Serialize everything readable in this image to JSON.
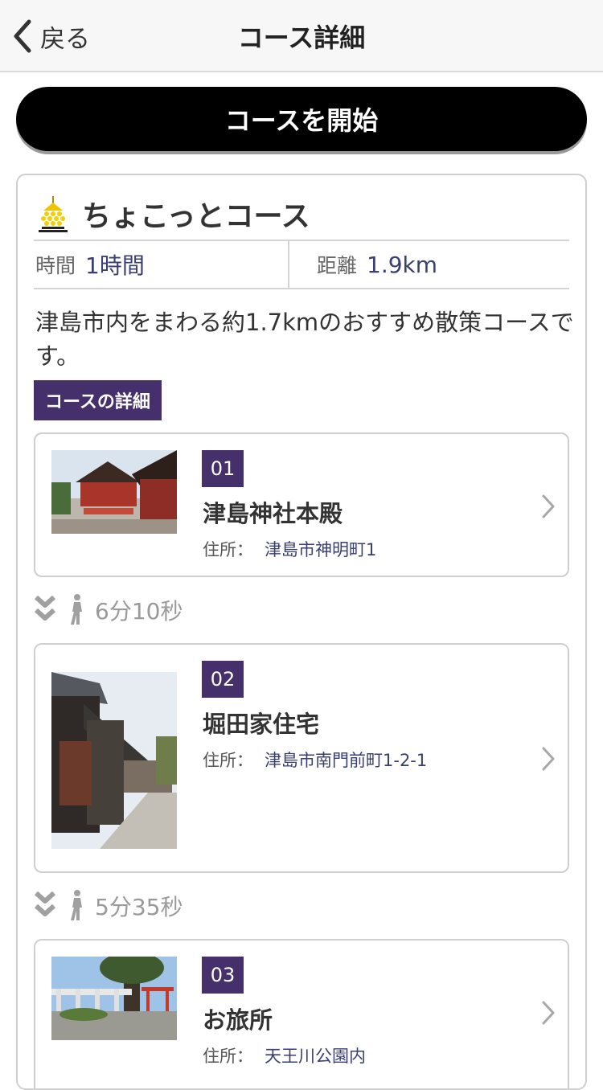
{
  "nav": {
    "back_label": "戻る",
    "title": "コース詳細"
  },
  "start_button": "コースを開始",
  "course": {
    "title": "ちょこっとコース",
    "time_label": "時間",
    "time_value": "1時間",
    "distance_label": "距離",
    "distance_value": "1.9km",
    "description": "津島市内をまわる約1.7kmのおすすめ散策コースです。",
    "details_label": "コースの詳細"
  },
  "spots": [
    {
      "number": "01",
      "name": "津島神社本殿",
      "address_label": "住所：",
      "address": "津島市神明町1",
      "image": "shrine-photo"
    },
    {
      "number": "02",
      "name": "堀田家住宅",
      "address_label": "住所：",
      "address": "津島市南門前町1-2-1",
      "image": "house-photo"
    },
    {
      "number": "03",
      "name": "お旅所",
      "address_label": "住所：",
      "address": "天王川公園内",
      "image": "park-photo"
    }
  ],
  "walks": [
    {
      "time": "6分10秒"
    },
    {
      "time": "5分35秒"
    }
  ],
  "colors": {
    "accent_purple": "#46306b",
    "value_navy": "#3a3f73",
    "button_black": "#000000"
  },
  "icons": {
    "back": "chevron-left-icon",
    "course": "lantern-icon",
    "row": "chevron-right-icon",
    "walk_arrow": "double-chevron-down-icon",
    "walker": "walking-person-icon"
  }
}
